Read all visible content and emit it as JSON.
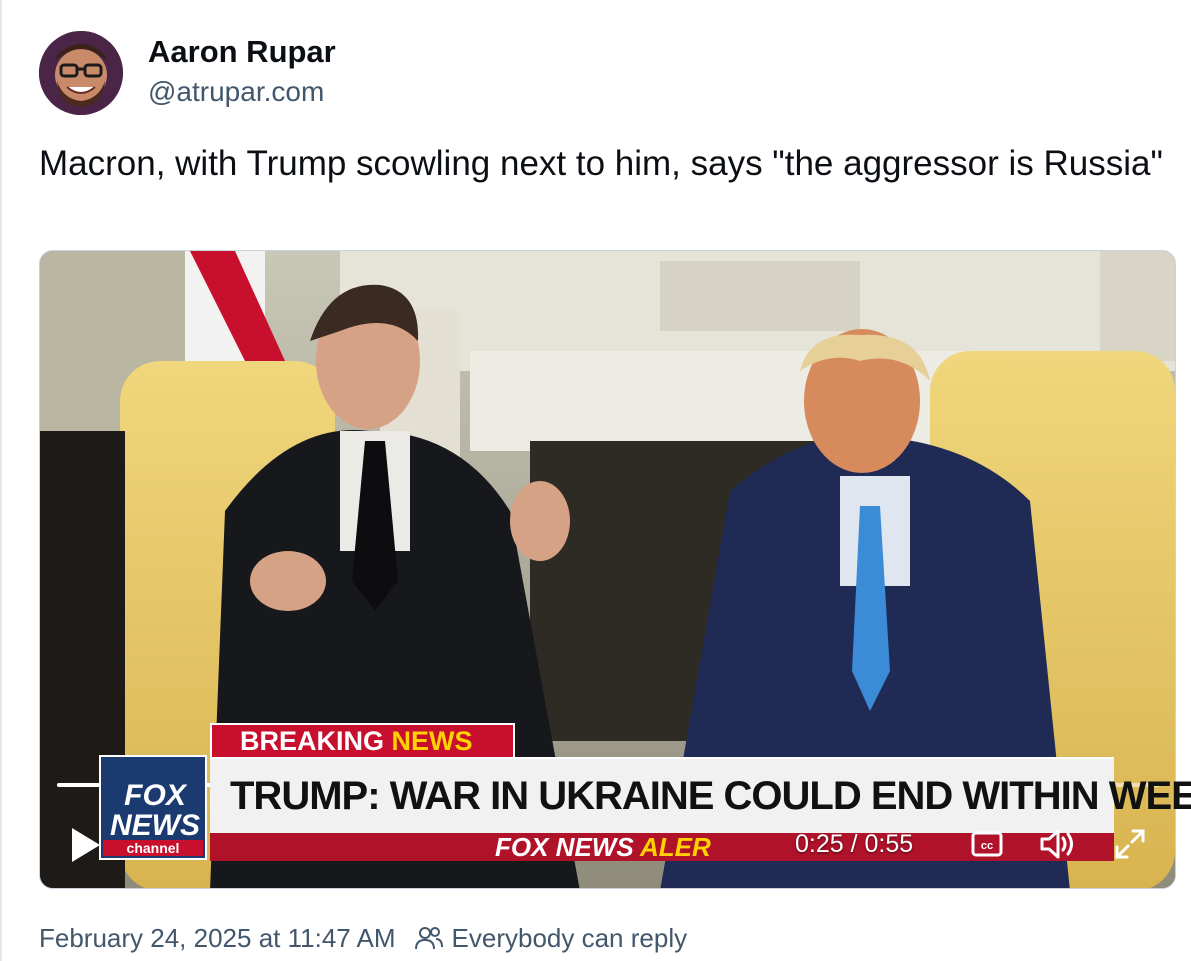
{
  "author": {
    "name": "Aaron Rupar",
    "handle": "@atrupar.com"
  },
  "post": {
    "text": "Macron, with Trump scowling next to him, says \"the aggressor is Russia\""
  },
  "video": {
    "chyron": {
      "banner_prefix": "BREAKING ",
      "banner_accent": "NEWS",
      "headline": "TRUMP: WAR IN UKRAINE COULD END WITHIN WEEKS",
      "alert_prefix": "FOX NEWS ",
      "alert_accent": "ALER",
      "logo_line1": "FOX",
      "logo_line2": "NEWS",
      "logo_line3": "channel"
    },
    "time_display": "0:25 / 0:55",
    "progress_fraction": 0.4545,
    "controls": {
      "play_icon": "play-icon",
      "cc_icon": "closed-captions-icon",
      "volume_icon": "volume-icon",
      "fullscreen_icon": "fullscreen-icon"
    }
  },
  "footer": {
    "timestamp": "February 24, 2025 at 11:47 AM",
    "reply_setting": "Everybody can reply",
    "reply_icon": "people-icon"
  },
  "colors": {
    "text_primary": "#0b0f14",
    "text_secondary": "#42576c",
    "fox_red": "#c8102e",
    "fox_yellow": "#ffd200",
    "fox_blue": "#1b3a6f"
  }
}
